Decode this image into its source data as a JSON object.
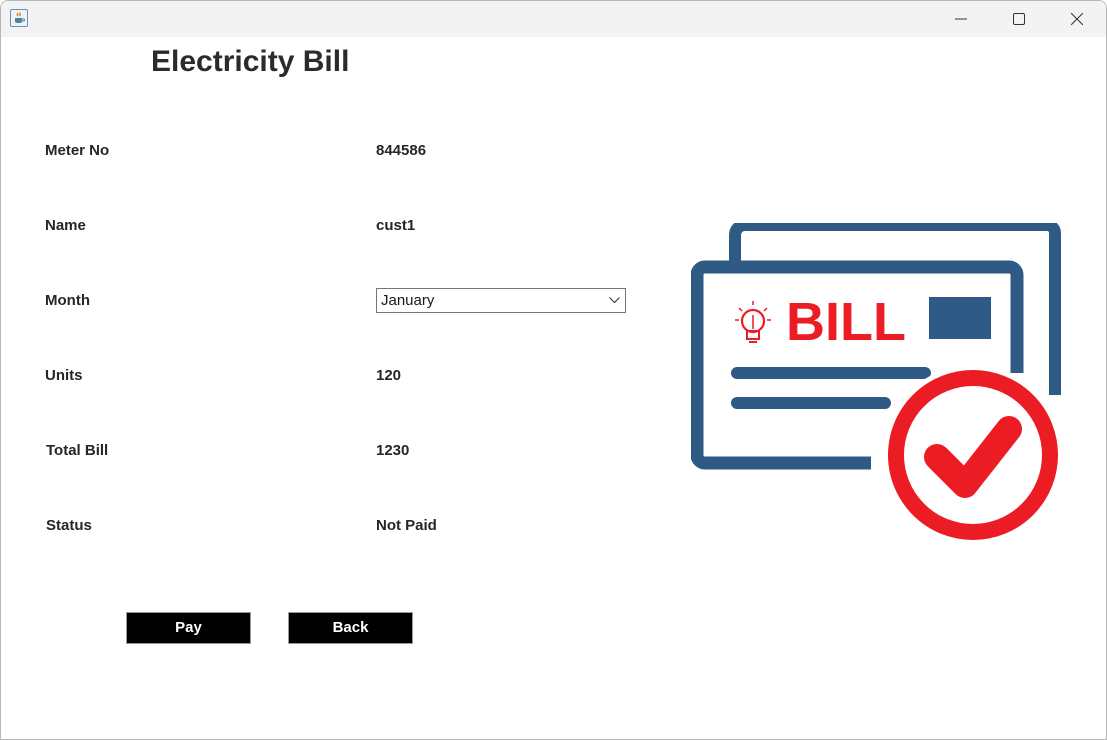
{
  "window": {
    "app_icon": "java-cup-icon",
    "controls": [
      "minimize-icon",
      "maximize-icon",
      "close-icon"
    ]
  },
  "page": {
    "title": "Electricity Bill"
  },
  "form": {
    "meter_no": {
      "label": "Meter No",
      "value": "844586"
    },
    "name": {
      "label": "Name",
      "value": "cust1"
    },
    "month": {
      "label": "Month",
      "selected": "January"
    },
    "units": {
      "label": "Units",
      "value": "120"
    },
    "total_bill": {
      "label": "Total Bill",
      "value": "1230"
    },
    "status": {
      "label": "Status",
      "value": "Not Paid"
    }
  },
  "actions": {
    "pay_label": "Pay",
    "back_label": "Back"
  },
  "illustration": {
    "bill_text": "BILL",
    "icon": "bill-paid-checkmark-icon",
    "colors": {
      "document": "#2e5a85",
      "accent": "#ec1c24"
    }
  },
  "colors": {
    "button_bg": "#000000",
    "button_text": "#ffffff",
    "titlebar_bg": "#f3f3f3"
  }
}
